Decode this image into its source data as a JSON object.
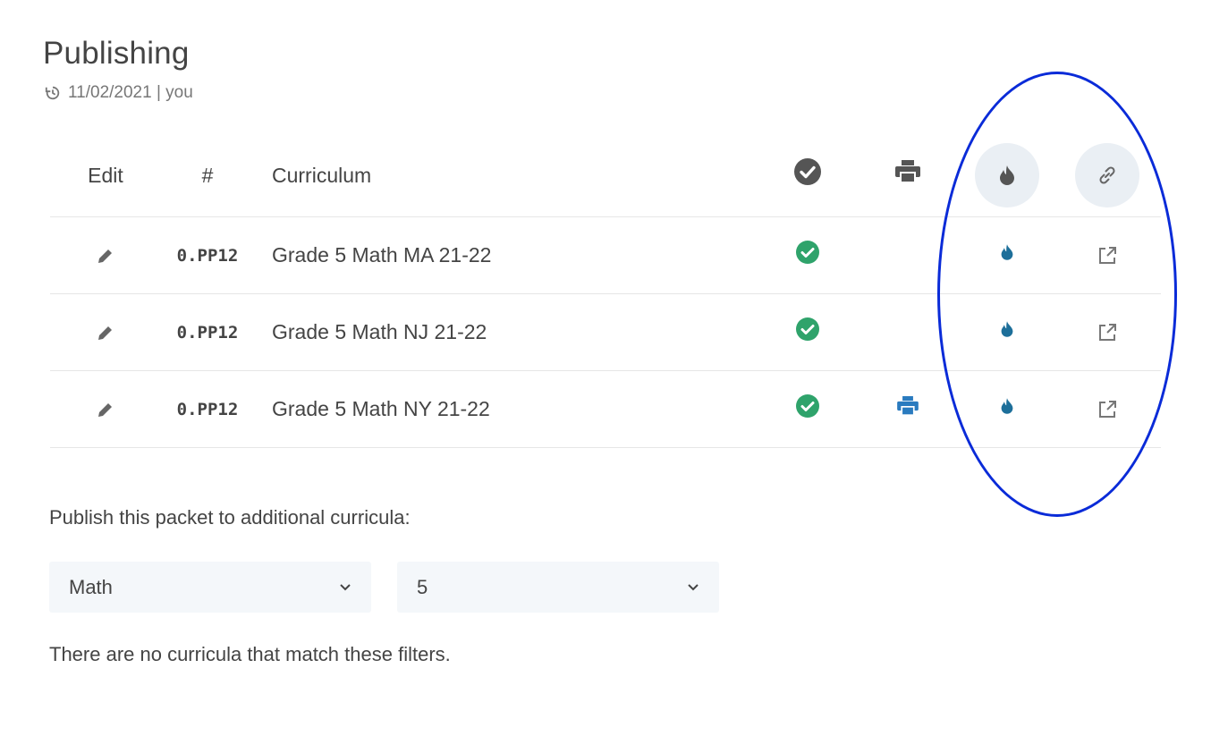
{
  "page": {
    "title": "Publishing",
    "meta": "11/02/2021 | you"
  },
  "table": {
    "headers": {
      "edit": "Edit",
      "num": "#",
      "curriculum": "Curriculum"
    },
    "rows": [
      {
        "num": "0.PP12",
        "curriculum": "Grade 5 Math MA 21-22",
        "published": true,
        "printable": false
      },
      {
        "num": "0.PP12",
        "curriculum": "Grade 5 Math NJ 21-22",
        "published": true,
        "printable": false
      },
      {
        "num": "0.PP12",
        "curriculum": "Grade 5 Math NY 21-22",
        "published": true,
        "printable": true
      }
    ]
  },
  "publish": {
    "label": "Publish this packet to additional curricula:",
    "subject_select": "Math",
    "grade_select": "5",
    "empty_message": "There are no curricula that match these filters."
  },
  "colors": {
    "check_green": "#2fa36b",
    "print_blue": "#2a7bbf",
    "fire_teal": "#1d6f9a",
    "header_icon": "#555555",
    "annotation": "#0a2bd8"
  },
  "icons": {
    "history": "history-icon",
    "edit": "pencil-icon",
    "check": "check-circle-icon",
    "print": "printer-icon",
    "fire": "fire-icon",
    "link": "link-icon",
    "external": "external-link-icon",
    "chevron": "chevron-down-icon"
  }
}
